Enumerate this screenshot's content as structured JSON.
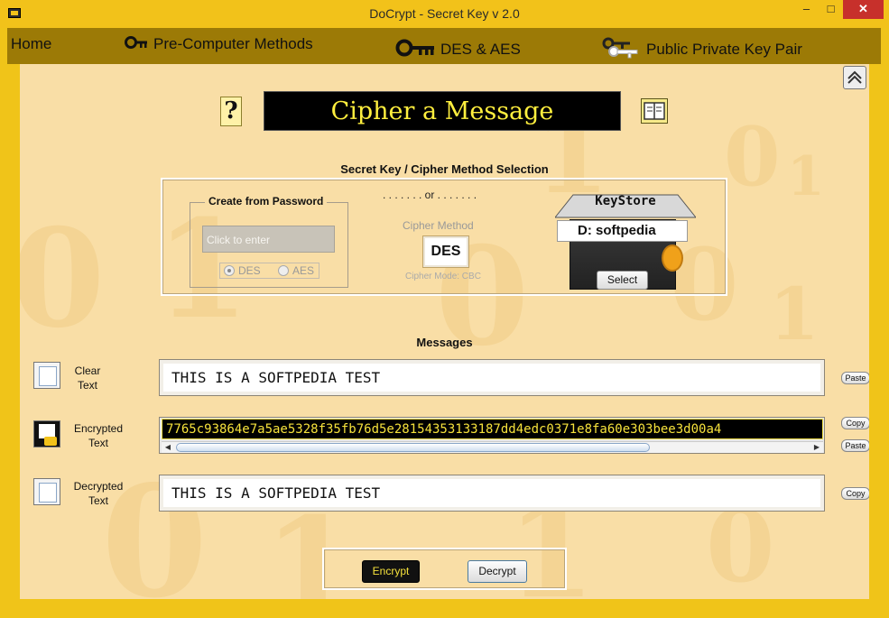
{
  "window": {
    "title": "DoCrypt - Secret Key v 2.0",
    "controls": {
      "minimize": "–",
      "maximize": "□",
      "close": "✕"
    }
  },
  "menu": {
    "items": [
      {
        "label": "Home",
        "icon": ""
      },
      {
        "label": "Pre-Computer Methods",
        "icon": "key-icon"
      },
      {
        "label": "DES & AES",
        "icon": "key-icon"
      },
      {
        "label": "Public Private Key Pair",
        "icon": "key-pair-icon"
      }
    ]
  },
  "header": {
    "help_icon_glyph": "?",
    "title": "Cipher a Message",
    "book_icon": "book-icon"
  },
  "selection": {
    "section_title": "Secret Key / Cipher Method Selection",
    "password_group_title": "Create from Password",
    "password_placeholder": "Click to enter",
    "radio_des": "DES",
    "radio_aes": "AES",
    "radio_selected": "DES",
    "or_separator": ". . . . . . .  or  . . . . . . .",
    "cipher_method_label": "Cipher Method",
    "cipher_method_value": "DES",
    "cipher_mode_text": "Cipher Mode: CBC",
    "keystore_title": "KeyStore",
    "keystore_label": "D:  softpedia",
    "keystore_select": "Select"
  },
  "messages": {
    "section_title": "Messages",
    "clear": {
      "label_line1": "Clear",
      "label_line2": "Text",
      "value": "THIS IS A SOFTPEDIA TEST",
      "paste_button": "Paste"
    },
    "encrypted": {
      "label_line1": "Encrypted",
      "label_line2": "Text",
      "value": "7765c93864e7a5ae5328f35fb76d5e28154353133187dd4edc0371e8fa60e303bee3d00a4",
      "copy_button": "Copy",
      "paste_button": "Paste"
    },
    "decrypted": {
      "label_line1": "Decrypted",
      "label_line2": "Text",
      "value": "THIS IS A SOFTPEDIA TEST",
      "copy_button": "Copy"
    }
  },
  "actions": {
    "encrypt_label": "Encrypt",
    "decrypt_label": "Decrypt"
  },
  "colors": {
    "frame": "#f0c419",
    "menu_bar": "#9c7a06",
    "content_bg": "#f9dea6",
    "banner_text": "#ffef3e",
    "close_button": "#c7302b"
  }
}
